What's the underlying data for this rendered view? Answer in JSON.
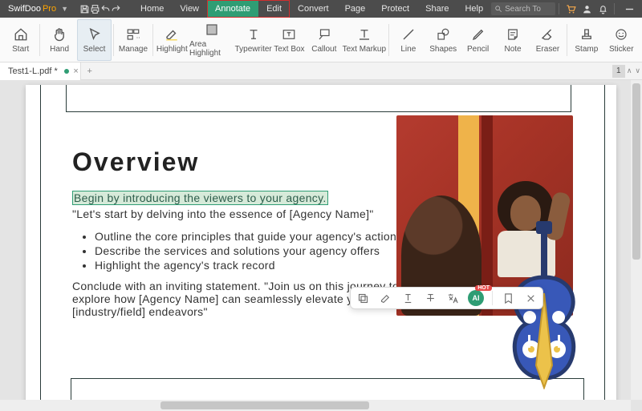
{
  "app": {
    "name": "SwifDoo",
    "suffix": "Pro"
  },
  "menu": {
    "items": [
      "Home",
      "View",
      "Annotate",
      "Edit",
      "Convert",
      "Page",
      "Protect",
      "Share",
      "Help"
    ],
    "highlighted": [
      "Annotate",
      "Edit"
    ],
    "search_placeholder": "Search To"
  },
  "ribbon": {
    "tools": [
      {
        "id": "start",
        "label": "Start",
        "icon": "home"
      },
      {
        "id": "hand",
        "label": "Hand",
        "icon": "hand"
      },
      {
        "id": "select",
        "label": "Select",
        "icon": "cursor",
        "selected": true
      },
      {
        "id": "manage",
        "label": "Manage",
        "icon": "manage"
      },
      {
        "id": "highlight",
        "label": "Highlight",
        "icon": "highlight"
      },
      {
        "id": "areahl",
        "label": "Area Highlight",
        "icon": "area-highlight"
      },
      {
        "id": "typewriter",
        "label": "Typewriter",
        "icon": "typewriter"
      },
      {
        "id": "textbox",
        "label": "Text Box",
        "icon": "textbox"
      },
      {
        "id": "callout",
        "label": "Callout",
        "icon": "callout"
      },
      {
        "id": "textmarkup",
        "label": "Text Markup",
        "icon": "text-markup"
      },
      {
        "id": "line",
        "label": "Line",
        "icon": "line"
      },
      {
        "id": "shapes",
        "label": "Shapes",
        "icon": "shapes"
      },
      {
        "id": "pencil",
        "label": "Pencil",
        "icon": "pencil"
      },
      {
        "id": "note",
        "label": "Note",
        "icon": "note"
      },
      {
        "id": "eraser",
        "label": "Eraser",
        "icon": "eraser"
      },
      {
        "id": "stamp",
        "label": "Stamp",
        "icon": "stamp"
      },
      {
        "id": "sticker",
        "label": "Sticker",
        "icon": "sticker"
      }
    ]
  },
  "tabs": {
    "open": [
      {
        "title": "Test1-L.pdf *",
        "modified": true
      }
    ],
    "page_indicator": "1"
  },
  "doc": {
    "heading": "Overview",
    "highlighted_line": "Begin by introducing the viewers to your agency.",
    "intro": "\"Let's start by delving into the essence of [Agency Name]\"",
    "bullets": [
      "Outline the core principles that guide your agency's actions",
      "Describe the services and solutions your agency offers",
      "Highlight the agency's track record"
    ],
    "conclude": "Conclude with an inviting statement. \"Join us on this journey to explore how [Agency Name] can seamlessly elevate your [industry/field] endeavors\""
  },
  "floatbar": {
    "items": [
      "copy",
      "highlight-pen",
      "text-underline",
      "text-strikethrough",
      "translate",
      "ai",
      "bookmark",
      "close"
    ],
    "ai_label": "AI",
    "ai_badge": "HOT"
  },
  "colors": {
    "accent_green": "#2f9d74",
    "accent_orange": "#ffa500",
    "menubar": "#4c4c4c"
  }
}
